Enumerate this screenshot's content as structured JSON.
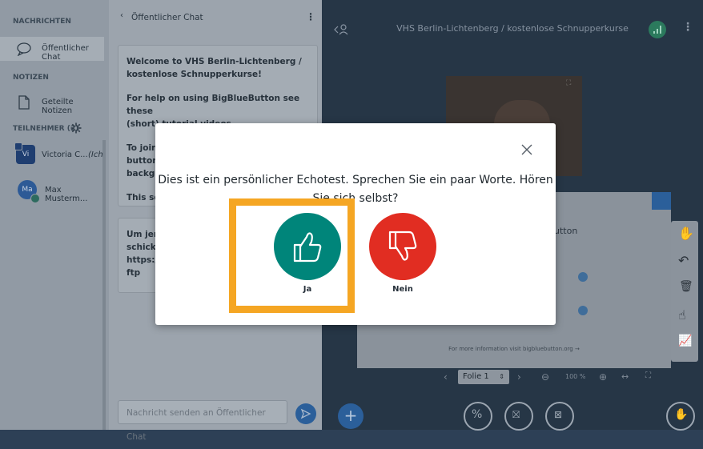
{
  "sidebar": {
    "messages_header": "NACHRICHTEN",
    "public_chat": "Öffentlicher Chat",
    "notes_header": "NOTIZEN",
    "shared_notes": "Geteilte Notizen",
    "participants_header": "TEILNEHMER (2)",
    "participants": [
      {
        "initials": "Vi",
        "name": "Victoria C...",
        "suffix": "(Ich"
      },
      {
        "initials": "Ma",
        "name": "Max Musterm..."
      }
    ]
  },
  "chat": {
    "header": "Öffentlicher Chat",
    "welcome_line1": "Welcome to VHS Berlin-Lichtenberg /",
    "welcome_line2": "kostenlose Schnupperkurse!",
    "help_line1": "For help on using BigBlueButton see these",
    "help_line2": "(short)",
    "help_link": "tutorial videos",
    "help_end": ".",
    "join_lines": [
      "To join",
      "button.",
      "backgr"
    ],
    "this_ses": "This ses",
    "box2_lines": [
      "Um jem",
      "schicke",
      "https:/",
      "ftp"
    ],
    "input_placeholder": "Nachricht senden an Öffentlicher Chat"
  },
  "main": {
    "title": "VHS Berlin-Lichtenberg / kostenlose Schnupperkurse",
    "slide_title_fragment": "utton",
    "slide_footer": "For more information visit bigbluebutton.org →",
    "slide_selector": "Folie 1",
    "zoom": "100 %"
  },
  "modal": {
    "prompt": "Dies ist ein persönlicher Echotest. Sprechen Sie ein paar Worte. Hören Sie sich selbst?",
    "yes_label": "Ja",
    "no_label": "Nein"
  },
  "colors": {
    "yes": "#00857a",
    "no": "#e12d22",
    "highlight": "#f5a623"
  }
}
